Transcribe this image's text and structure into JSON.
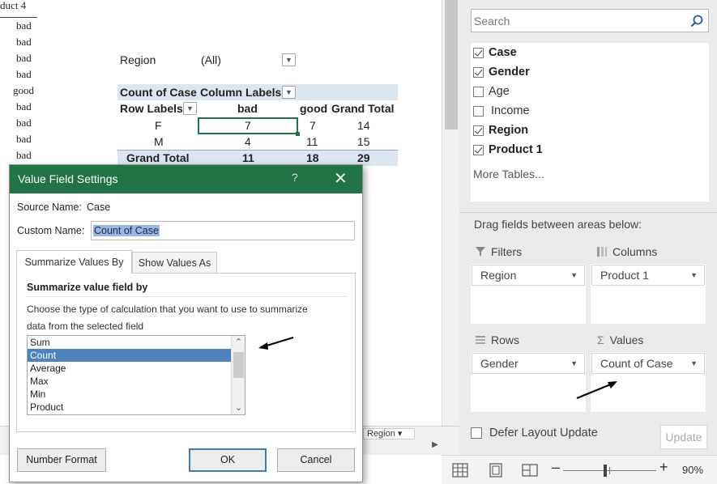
{
  "sheet": {
    "column_a": [
      "duct 4",
      "bad",
      "bad",
      "bad",
      "bad",
      "good",
      "bad",
      "bad",
      "bad",
      "bad"
    ],
    "pivot": {
      "filter_label": "Region",
      "filter_value": "(All)",
      "corner": "Count of Case",
      "column_labels": "Column Labels",
      "row_labels": "Row Labels",
      "col_headers": [
        "bad",
        "good",
        "Grand Total"
      ],
      "rows": [
        {
          "label": "F",
          "values": [
            "7",
            "7",
            "14"
          ]
        },
        {
          "label": "M",
          "values": [
            "4",
            "11",
            "15"
          ]
        }
      ],
      "grand_total": {
        "label": "Grand Total",
        "values": [
          "11",
          "18",
          "29"
        ]
      }
    },
    "sheet_tab": "Region"
  },
  "status_bar": {
    "zoom_level": "90%",
    "view_icons": [
      "normal-view-icon",
      "page-layout-view-icon",
      "page-break-view-icon"
    ]
  },
  "field_pane": {
    "search": {
      "placeholder": "Search"
    },
    "fields": [
      {
        "label": "Case",
        "checked": true
      },
      {
        "label": "Gender",
        "checked": true
      },
      {
        "label": "Age",
        "checked": false
      },
      {
        "label": "Income",
        "checked": false
      },
      {
        "label": "Region",
        "checked": true
      },
      {
        "label": "Product 1",
        "checked": true
      }
    ],
    "more_tables": "More Tables...",
    "drag_hint": "Drag fields between areas below:",
    "areas": {
      "filters": {
        "title": "Filters",
        "item": "Region"
      },
      "columns": {
        "title": "Columns",
        "item": "Product 1"
      },
      "rows": {
        "title": "Rows",
        "item": "Gender"
      },
      "values": {
        "title": "Values",
        "item": "Count of Case"
      }
    },
    "defer_label": "Defer Layout Update",
    "update_label": "Update"
  },
  "dialog": {
    "title": "Value Field Settings",
    "help": "?",
    "close": "✕",
    "source_name_label": "Source Name:",
    "source_name_value": "Case",
    "custom_name_label": "Custom Name:",
    "custom_name_value": "Count of Case",
    "tabs": [
      "Summarize Values By",
      "Show Values As"
    ],
    "section_title": "Summarize value field by",
    "description": "Choose the type of calculation that you want to use to summarize data from the selected field",
    "calc_options": [
      "Sum",
      "Count",
      "Average",
      "Max",
      "Min",
      "Product"
    ],
    "selected_option": "Count",
    "buttons": {
      "number_format": "Number Format",
      "ok": "OK",
      "cancel": "Cancel"
    }
  },
  "colors": {
    "excel_green": "#217346",
    "pivot_header": "#dce6f1",
    "selection_blue": "#4f81bd",
    "pane_bg": "#eaeaea"
  }
}
